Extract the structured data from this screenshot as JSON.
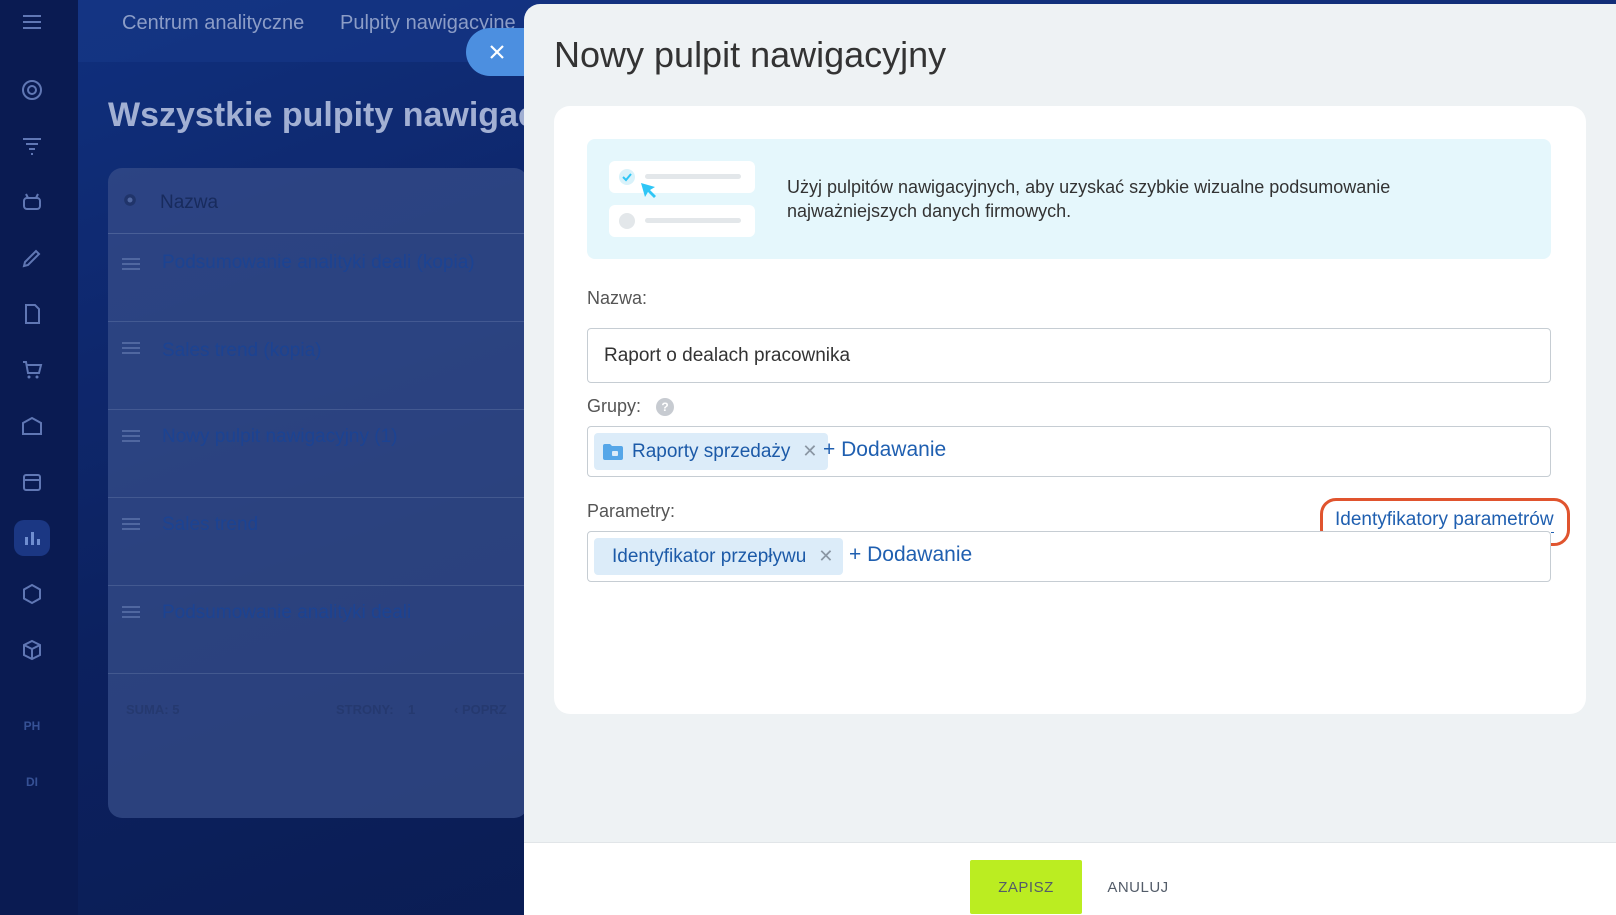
{
  "topnav": {
    "items": [
      "Centrum analityczne",
      "Pulpity nawigacyjne"
    ]
  },
  "leftbar": {
    "icons": [
      "target-icon",
      "funnel-icon",
      "robot-icon",
      "pen-icon",
      "document-icon",
      "cart-icon",
      "warehouse-icon",
      "calendar-icon",
      "bar-chart-icon",
      "hexagon-icon",
      "box-icon"
    ],
    "badges": [
      "PH",
      "DI"
    ]
  },
  "background": {
    "page_title": "Wszystkie pulpity nawigacy",
    "column_header": "Nazwa",
    "rows": [
      "Podsumowanie analityki deali (kopia)",
      "Sales trend (kopia)",
      "Nowy pulpit nawigacyjny (1)",
      "Sales trend",
      "Podsumowanie analityki deali"
    ],
    "footer": {
      "total_label": "SUMA:",
      "total_value": "5",
      "pages_label": "STRONY:",
      "pages_value": "1",
      "prev_label": "POPRZ"
    }
  },
  "slider": {
    "title": "Nowy pulpit nawigacyjny",
    "banner_text": "Użyj pulpitów nawigacyjnych, aby uzyskać szybkie wizualne podsumowanie najważniejszych danych firmowych.",
    "name_label": "Nazwa:",
    "name_value": "Raport o dealach pracownika",
    "groups_label": "Grupy:",
    "groups_tags": [
      "Raporty sprzedaży"
    ],
    "groups_add": "+ Dodawanie",
    "params_label": "Parametry:",
    "params_link": "Identyfikatory parametrów",
    "params_tags": [
      "Identyfikator przepływu"
    ],
    "params_add": "+ Dodawanie",
    "save_label": "ZAPISZ",
    "cancel_label": "ANULUJ",
    "help_glyph": "?"
  },
  "colors": {
    "accent_link": "#1f5fb0",
    "save_button": "#bbed21",
    "highlight": "#e0542e",
    "banner_bg": "#e5f7fc"
  }
}
